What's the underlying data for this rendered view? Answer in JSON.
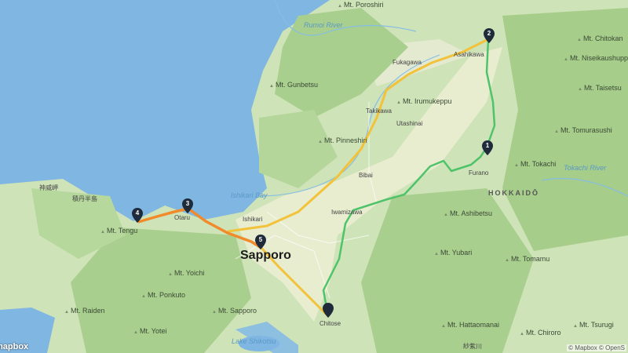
{
  "map": {
    "attribution": "© Mapbox © OpenS",
    "logo": "mapbox"
  },
  "labels": {
    "sapporo": "Sapporo",
    "otaru": "Otaru",
    "ishikari": "Ishikari",
    "iwamizawa": "Iwamizawa",
    "bibai": "Bibai",
    "takikawa": "Takikawa",
    "fukagawa": "Fukagawa",
    "asahikawa": "Asahikawa",
    "furano": "Furano",
    "chitose": "Chitose",
    "utashinai": "Utashinai",
    "hokkaido": "HOKKAIDŌ",
    "rumoi_river": "Rumoi River",
    "ishikari_bay": "Ishikari Bay",
    "tokachi_river": "Tokachi River",
    "lake_shikotsu": "Lake Shikotsu",
    "shakotan_jp": "神威岬",
    "shakotan_peninsula": "積丹半島",
    "kaminokawa": "紗紫川"
  },
  "peaks": [
    "Mt. Poroshiri",
    "Mt. Gunbetsu",
    "Mt. Irumukeppu",
    "Mt. Pinneshiri",
    "Mt. Tengu",
    "Mt. Yoichi",
    "Mt. Ponkuto",
    "Mt. Raiden",
    "Mt. Yotei",
    "Mt. Sapporo",
    "Mt. Ashibetsu",
    "Mt. Yubari",
    "Mt. Hattaomanai",
    "Mt. Tomamu",
    "Mt. Chiroro",
    "Mt. Tsurugi",
    "Mt. Tokachi",
    "Mt. Tomurasushi",
    "Mt. Taisetsu",
    "Mt. Niseikaushuppe",
    "Mt. Chitokan"
  ],
  "markers": [
    {
      "number": "1",
      "place": "Furano"
    },
    {
      "number": "2",
      "place": "Asahikawa"
    },
    {
      "number": "3",
      "place": "Otaru"
    },
    {
      "number": "4",
      "place": "Shakotan"
    },
    {
      "number": "5",
      "place": "Sapporo"
    },
    {
      "number": "",
      "place": "Chitose"
    }
  ],
  "colors": {
    "sea": "#7fb6e2",
    "land": "#c9dfb3",
    "route_green": "#4fc36a",
    "route_orange": "#f08a2b",
    "route_yellow": "#f2c23a",
    "pin": "#1f2b3a"
  }
}
